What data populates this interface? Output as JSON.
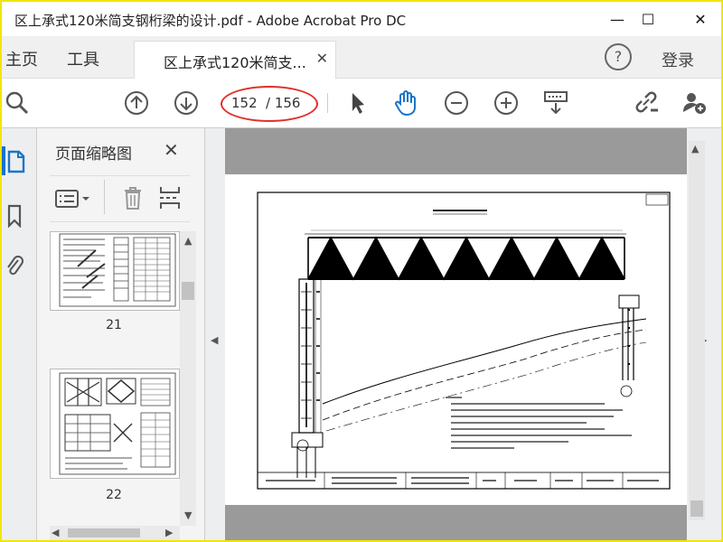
{
  "window": {
    "title": "区上承式120米简支钢桁梁的设计.pdf - Adobe Acrobat Pro DC",
    "minimize_label": "—",
    "maximize_label": "☐",
    "close_label": "✕"
  },
  "tabs": {
    "home": "主页",
    "tools": "工具",
    "document": "区上承式120米简支...",
    "close": "✕"
  },
  "account": {
    "help": "?",
    "login": "登录"
  },
  "toolbar": {
    "current_page": "152",
    "total_pages": "/ 156",
    "icons": [
      "search-icon",
      "page-up-icon",
      "page-down-icon",
      "select-cursor-icon",
      "hand-icon",
      "zoom-out-icon",
      "zoom-in-icon",
      "keyboard-icon",
      "link-icon",
      "add-user-icon"
    ]
  },
  "panel": {
    "title": "页面缩略图",
    "close": "✕",
    "thumbnails": [
      {
        "page": "21"
      },
      {
        "page": "22"
      }
    ]
  },
  "colors": {
    "accent": "#1a74c9",
    "highlight": "#e0302a",
    "frame": "#f2e600"
  }
}
